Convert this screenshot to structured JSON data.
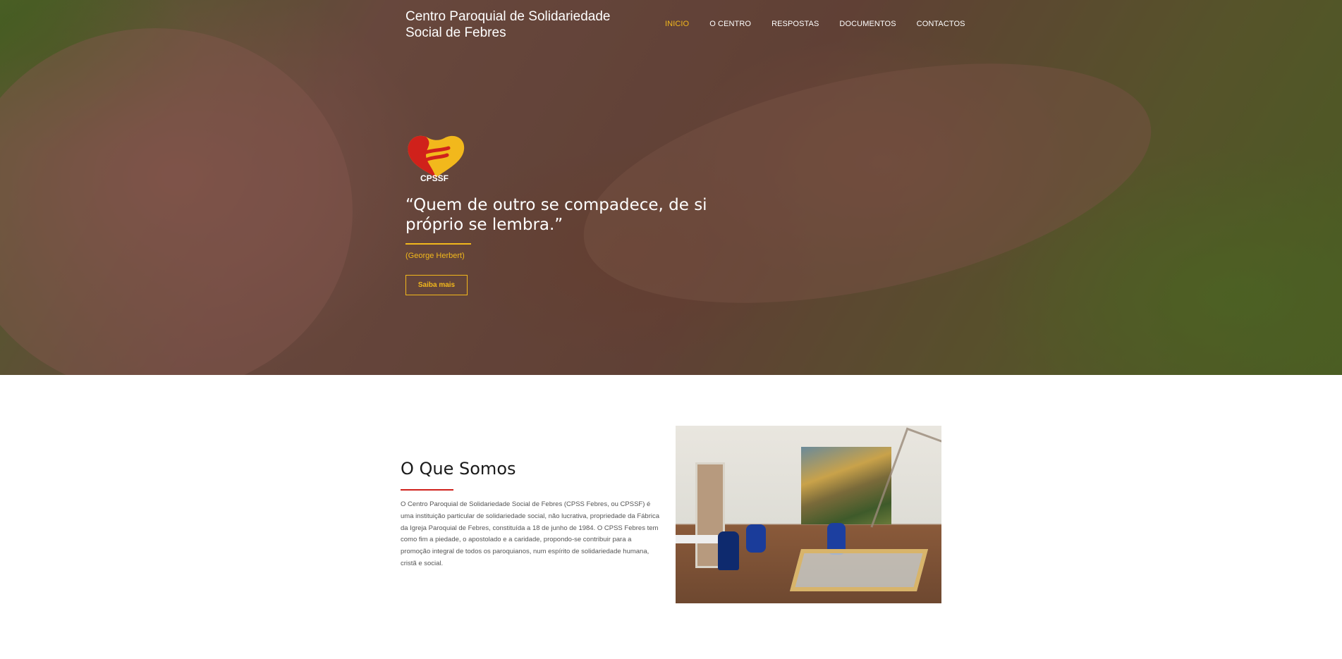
{
  "header": {
    "site_title": "Centro Paroquial de Solidariedade Social de Febres",
    "nav": [
      {
        "label": "INICIO",
        "active": true
      },
      {
        "label": "O CENTRO",
        "active": false
      },
      {
        "label": "RESPOSTAS",
        "active": false
      },
      {
        "label": "DOCUMENTOS",
        "active": false
      },
      {
        "label": "CONTACTOS",
        "active": false
      }
    ]
  },
  "hero": {
    "logo_text": "CPSSF",
    "quote": "“Quem de outro se compadece, de si próprio se lembra.”",
    "author": "(George Herbert)",
    "button_label": "Saiba mais"
  },
  "about": {
    "heading": "O Que Somos",
    "text": "O Centro Paroquial de Solidariedade Social de Febres (CPSS Febres, ou CPSSF) é uma instituição particular de solidariedade social, não lucrativa, propriedade da Fábrica da Igreja Paroquial de Febres, constituída a 18 de junho de 1984. O CPSS Febres tem como fim a piedade, o apostolado e a caridade, propondo-se contribuir para a promoção integral de todos os paroquianos, num espírito de solidariedade humana, cristã e social."
  },
  "colors": {
    "accent": "#f2b81c",
    "heading_rule": "#d0211b",
    "logo_red": "#d0211b",
    "logo_yellow": "#f2b81c"
  }
}
